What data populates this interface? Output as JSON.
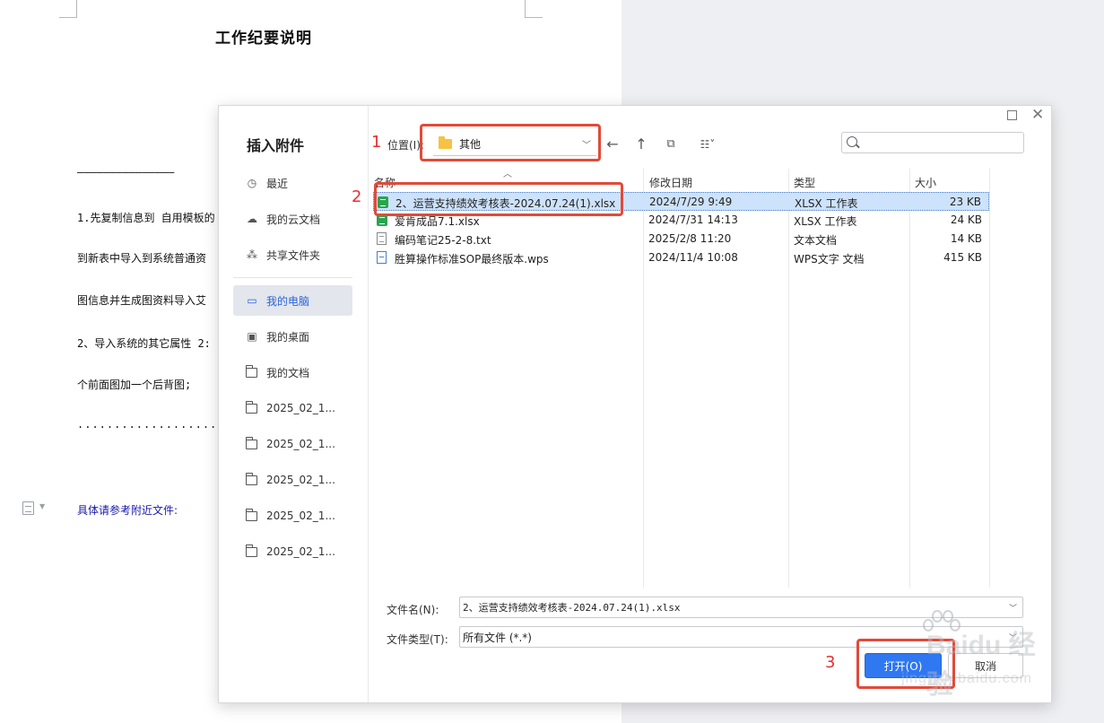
{
  "document": {
    "title": "工作纪要说明",
    "dash_line": "———————————————",
    "lines": [
      "1.先复制信息到 自用模板的",
      "到新表中导入到系统普通资",
      "图信息并生成图资料导入艾",
      "2、导入系统的其它属性 2:",
      "个前面图加一个后背图;"
    ],
    "dots_line": "...........................",
    "reference": "具体请参考附近文件:"
  },
  "dialog": {
    "title": "插入附件",
    "sidebar": [
      {
        "label": "最近",
        "icon": "clock-icon"
      },
      {
        "label": "我的云文档",
        "icon": "cloud-icon"
      },
      {
        "label": "共享文件夹",
        "icon": "share-icon"
      },
      {
        "label": "我的电脑",
        "icon": "computer-icon"
      },
      {
        "label": "我的桌面",
        "icon": "desktop-icon"
      },
      {
        "label": "我的文档",
        "icon": "documents-icon"
      },
      {
        "label": "2025_02_1...",
        "icon": "folder-icon"
      },
      {
        "label": "2025_02_1...",
        "icon": "folder-icon"
      },
      {
        "label": "2025_02_1...",
        "icon": "folder-icon"
      },
      {
        "label": "2025_02_1...",
        "icon": "folder-icon"
      },
      {
        "label": "2025_02_1...",
        "icon": "folder-icon"
      }
    ],
    "location": {
      "step": "1",
      "label": "位置(I):",
      "value": "其他"
    },
    "columns": {
      "name": "名称",
      "date": "修改日期",
      "type": "类型",
      "size": "大小"
    },
    "files": [
      {
        "name": "2、运营支持绩效考核表-2024.07.24(1).xlsx",
        "date": "2024/7/29 9:49",
        "type": "XLSX 工作表",
        "size": "23 KB",
        "icon": "xlsx-icon",
        "selected": true
      },
      {
        "name": "爱肯成品7.1.xlsx",
        "date": "2024/7/31 14:13",
        "type": "XLSX 工作表",
        "size": "24 KB",
        "icon": "xlsx-icon",
        "selected": false
      },
      {
        "name": "编码笔记25-2-8.txt",
        "date": "2025/2/8 11:20",
        "type": "文本文档",
        "size": "14 KB",
        "icon": "txt-icon",
        "selected": false
      },
      {
        "name": "胜算操作标准SOP最终版本.wps",
        "date": "2024/11/4 10:08",
        "type": "WPS文字 文档",
        "size": "415 KB",
        "icon": "wps-icon",
        "selected": false
      }
    ],
    "row_step": "2",
    "filename": {
      "label": "文件名(N):",
      "value": "2、运营支持绩效考核表-2024.07.24(1).xlsx"
    },
    "filetype": {
      "label": "文件类型(T):",
      "value": "所有文件 (*.*)"
    },
    "buttons": {
      "open": "打开(O)",
      "cancel": "取消",
      "step": "3"
    }
  },
  "watermark": {
    "brand": "Baidu 经验",
    "url": "jingyan.baidu.com"
  },
  "colors": {
    "accent": "#2f78f2",
    "annotation": "#e14a3a",
    "selected_row": "#cde2fb",
    "sidebar_active": "#e3e6ed"
  }
}
